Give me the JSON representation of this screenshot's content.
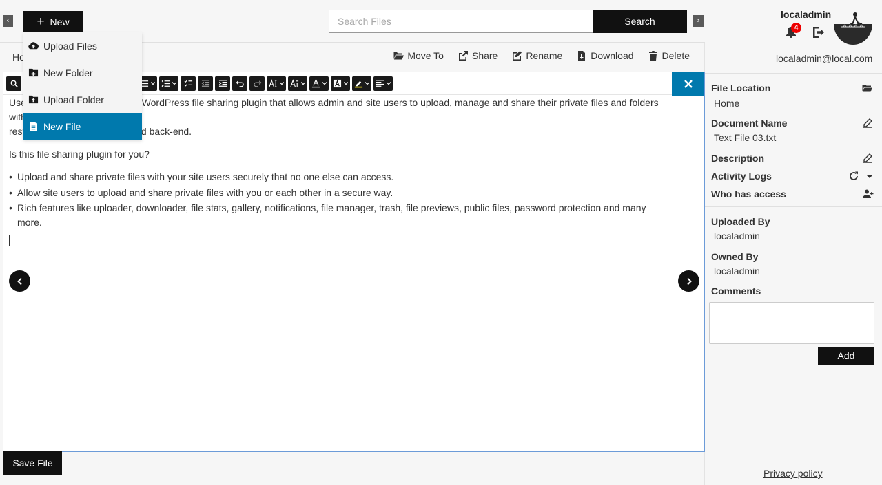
{
  "header": {
    "new_label": "New",
    "search_placeholder": "Search Files",
    "search_label": "Search"
  },
  "new_menu": {
    "items": [
      {
        "label": "Upload Files",
        "icon": "cloud-upload-icon"
      },
      {
        "label": "New Folder",
        "icon": "folder-plus-icon"
      },
      {
        "label": "Upload Folder",
        "icon": "folder-upload-icon"
      },
      {
        "label": "New File",
        "icon": "file-icon",
        "active": true
      }
    ]
  },
  "breadcrumb": "Ho",
  "actions": [
    {
      "label": "Move To",
      "icon": "folder-open-icon"
    },
    {
      "label": "Share",
      "icon": "share-icon"
    },
    {
      "label": "Rename",
      "icon": "rename-icon"
    },
    {
      "label": "Download",
      "icon": "download-icon"
    },
    {
      "label": "Delete",
      "icon": "trash-icon"
    }
  ],
  "editor": {
    "paragraph1_prefix": "Use",
    "paragraph1_main": "WordPress file sharing plugin that allows admin and site users to upload, manage and share their private files and folders with",
    "paragraph1_line2_prefix": "rest",
    "paragraph1_line2_main": "nd back-end.",
    "question": "Is this file sharing plugin for you?",
    "bullets": [
      "Upload and share private files with your site users securely that no one else can access.",
      "Allow site users to upload and share private files with you or each other in a secure way.",
      "Rich features like uploader, downloader, file stats, gallery, notifications, file manager, trash, file previews, public files, password protection and many more."
    ],
    "save_label": "Save File"
  },
  "user": {
    "name": "localadmin",
    "email": "localadmin@local.com",
    "notifications": "4"
  },
  "details": {
    "file_location_label": "File Location",
    "file_location": "Home",
    "document_name_label": "Document Name",
    "document_name": "Text File 03.txt",
    "description_label": "Description",
    "activity_logs_label": "Activity Logs",
    "who_has_access_label": "Who has access",
    "uploaded_by_label": "Uploaded By",
    "uploaded_by": "localadmin",
    "owned_by_label": "Owned By",
    "owned_by": "localadmin",
    "comments_label": "Comments",
    "add_label": "Add",
    "privacy_label": "Privacy policy"
  },
  "colors": {
    "accent": "#0079ad",
    "dark": "#111111",
    "badge": "#ee0000"
  }
}
